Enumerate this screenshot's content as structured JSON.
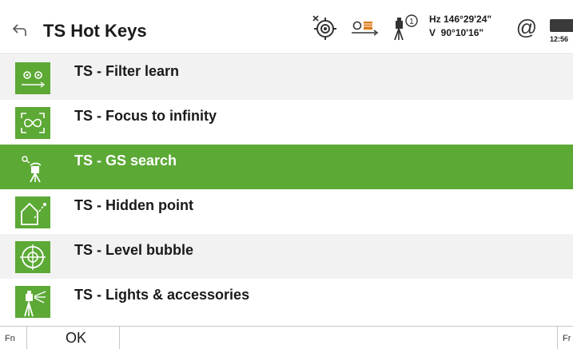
{
  "header": {
    "title": "TS Hot Keys",
    "angle_hz": "Hz 146°29'24\"",
    "angle_v": "V  90°10'16\"",
    "connection_symbol": "@",
    "time": "12:56"
  },
  "icons": {
    "back": "back-arrow-icon",
    "prism": "prism-target-icon",
    "search": "search-status-icon",
    "instrument": "instrument-face-icon",
    "battery": "battery-icon"
  },
  "colors": {
    "accent_green": "#5ca936",
    "row_alt": "#f2f2f2",
    "text": "#1a1a1a"
  },
  "items": [
    {
      "label": "TS - Filter learn",
      "icon": "filter-learn-icon"
    },
    {
      "label": "TS - Focus to infinity",
      "icon": "focus-infinity-icon"
    },
    {
      "label": "TS - GS search",
      "icon": "gs-search-icon",
      "selected": true
    },
    {
      "label": "TS - Hidden point",
      "icon": "hidden-point-icon"
    },
    {
      "label": "TS - Level bubble",
      "icon": "level-bubble-icon"
    },
    {
      "label": "TS - Lights & accessories",
      "icon": "lights-accessories-icon"
    }
  ],
  "softkeys": {
    "fn_left": "Fn",
    "ok": "OK",
    "fn_right": "Fr"
  }
}
